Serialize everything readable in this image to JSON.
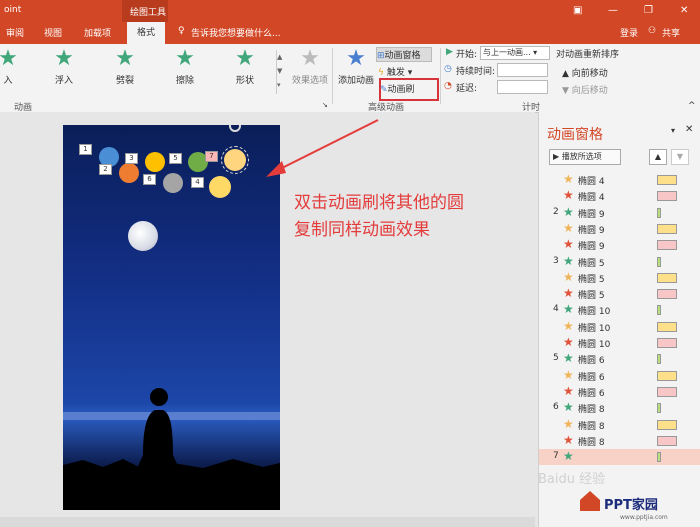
{
  "titlebar": {
    "app_fragment": "oint",
    "drawing_tools": "绘图工具"
  },
  "tabs": [
    "审阅",
    "视图",
    "加载项",
    "格式"
  ],
  "tell_me": "告诉我您想要做什么...",
  "account": {
    "login": "登录",
    "share": "共享"
  },
  "ribbon": {
    "gallery": [
      "入",
      "浮入",
      "劈裂",
      "擦除",
      "形状"
    ],
    "effect_options": "效果选项",
    "group_animation": "动画",
    "add_animation": "添加动画",
    "animation_pane": "动画窗格",
    "trigger": "触发",
    "animation_painter": "动画刷",
    "group_advanced": "高级动画",
    "start_label": "开始:",
    "start_value": "与上一动画...",
    "duration_label": "持续时间:",
    "delay_label": "延迟:",
    "reorder": "对动画重新排序",
    "move_earlier": "向前移动",
    "move_later": "向后移动",
    "group_timing": "计时"
  },
  "slide": {
    "labels": [
      "1",
      "2",
      "3",
      "4",
      "5",
      "6",
      "7"
    ]
  },
  "annotation": {
    "line1": "双击动画刷将其他的圆",
    "line2": "复制同样动画效果"
  },
  "pane": {
    "title": "动画窗格",
    "play": "播放所选项",
    "rows": [
      {
        "n": "",
        "star": "#f0b45a",
        "name": "椭圆 4",
        "bar": "#ffe08a"
      },
      {
        "n": "",
        "star": "#e0533a",
        "name": "椭圆 4",
        "bar": "#f8c6c6"
      },
      {
        "n": "2",
        "star": "#41a67a",
        "name": "椭圆 9",
        "bar": "#b7e07a"
      },
      {
        "n": "",
        "star": "#f0b45a",
        "name": "椭圆 9",
        "bar": "#ffe08a"
      },
      {
        "n": "",
        "star": "#e0533a",
        "name": "椭圆 9",
        "bar": "#f8c6c6"
      },
      {
        "n": "3",
        "star": "#41a67a",
        "name": "椭圆 5",
        "bar": "#b7e07a"
      },
      {
        "n": "",
        "star": "#f0b45a",
        "name": "椭圆 5",
        "bar": "#ffe08a"
      },
      {
        "n": "",
        "star": "#e0533a",
        "name": "椭圆 5",
        "bar": "#f8c6c6"
      },
      {
        "n": "4",
        "star": "#41a67a",
        "name": "椭圆 10",
        "bar": "#b7e07a"
      },
      {
        "n": "",
        "star": "#f0b45a",
        "name": "椭圆 10",
        "bar": "#ffe08a"
      },
      {
        "n": "",
        "star": "#e0533a",
        "name": "椭圆 10",
        "bar": "#f8c6c6"
      },
      {
        "n": "5",
        "star": "#41a67a",
        "name": "椭圆 6",
        "bar": "#b7e07a"
      },
      {
        "n": "",
        "star": "#f0b45a",
        "name": "椭圆 6",
        "bar": "#ffe08a"
      },
      {
        "n": "",
        "star": "#e0533a",
        "name": "椭圆 6",
        "bar": "#f8c6c6"
      },
      {
        "n": "6",
        "star": "#41a67a",
        "name": "椭圆 8",
        "bar": "#b7e07a"
      },
      {
        "n": "",
        "star": "#f0b45a",
        "name": "椭圆 8",
        "bar": "#ffe08a"
      },
      {
        "n": "",
        "star": "#e0533a",
        "name": "椭圆 8",
        "bar": "#f8c6c6"
      },
      {
        "n": "7",
        "star": "#41a67a",
        "name": "",
        "bar": "#b7e07a"
      }
    ]
  },
  "watermark": {
    "text1": "Baidu 经验",
    "text2": "PPT家园",
    "text3": "www.pptjia.com"
  }
}
